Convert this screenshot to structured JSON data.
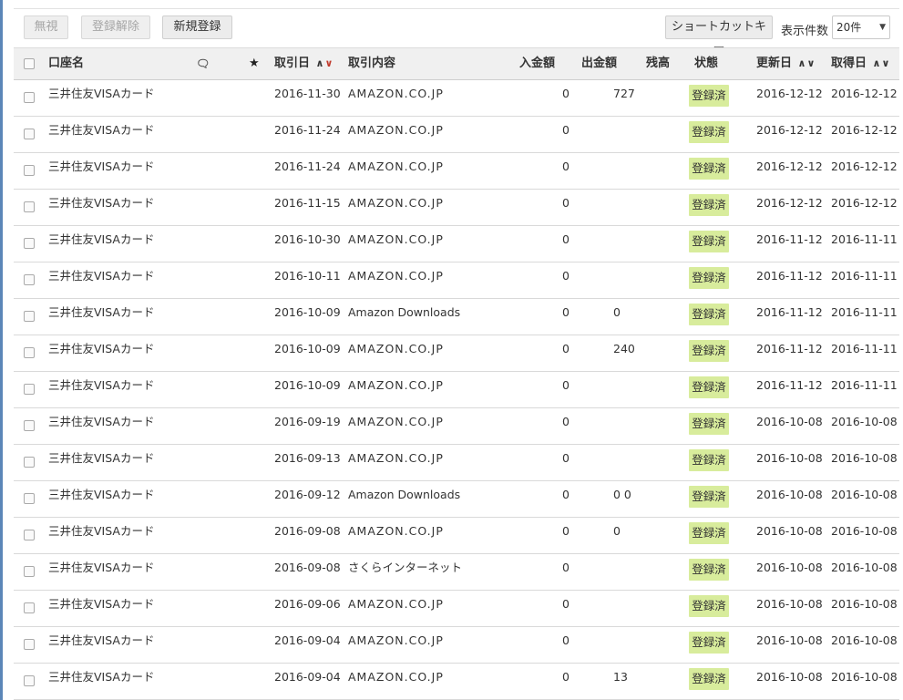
{
  "toolbar": {
    "ignore_label": "無視",
    "unregister_label": "登録解除",
    "new_label": "新規登録",
    "shortcut_label": "ショートカットキー",
    "count_label": "表示件数",
    "count_value": "20件"
  },
  "columns": {
    "account": "口座名",
    "date": "取引日",
    "content": "取引内容",
    "deposit": "入金額",
    "withdrawal": "出金額",
    "balance": "残高",
    "status": "状態",
    "updated": "更新日",
    "acquired": "取得日",
    "sort_up": "∧",
    "sort_down": "∨"
  },
  "rows": [
    {
      "account": "三井住友VISAカード",
      "date": "2016-11-30",
      "content": "AMAZON.CO.JP",
      "deposit": "0",
      "withdrawal": "727",
      "status": "登録済",
      "updated": "2016-12-12",
      "acquired": "2016-12-12"
    },
    {
      "account": "三井住友VISAカード",
      "date": "2016-11-24",
      "content": "AMAZON.CO.JP",
      "deposit": "0",
      "withdrawal": "",
      "status": "登録済",
      "updated": "2016-12-12",
      "acquired": "2016-12-12"
    },
    {
      "account": "三井住友VISAカード",
      "date": "2016-11-24",
      "content": "AMAZON.CO.JP",
      "deposit": "0",
      "withdrawal": "",
      "status": "登録済",
      "updated": "2016-12-12",
      "acquired": "2016-12-12"
    },
    {
      "account": "三井住友VISAカード",
      "date": "2016-11-15",
      "content": "AMAZON.CO.JP",
      "deposit": "0",
      "withdrawal": "",
      "status": "登録済",
      "updated": "2016-12-12",
      "acquired": "2016-12-12"
    },
    {
      "account": "三井住友VISAカード",
      "date": "2016-10-30",
      "content": "AMAZON.CO.JP",
      "deposit": "0",
      "withdrawal": "",
      "status": "登録済",
      "updated": "2016-11-12",
      "acquired": "2016-11-11"
    },
    {
      "account": "三井住友VISAカード",
      "date": "2016-10-11",
      "content": "AMAZON.CO.JP",
      "deposit": "0",
      "withdrawal": "",
      "status": "登録済",
      "updated": "2016-11-12",
      "acquired": "2016-11-11"
    },
    {
      "account": "三井住友VISAカード",
      "date": "2016-10-09",
      "content": "Amazon Downloads",
      "deposit": "0",
      "withdrawal": "0",
      "status": "登録済",
      "updated": "2016-11-12",
      "acquired": "2016-11-11"
    },
    {
      "account": "三井住友VISAカード",
      "date": "2016-10-09",
      "content": "AMAZON.CO.JP",
      "deposit": "0",
      "withdrawal": "240",
      "status": "登録済",
      "updated": "2016-11-12",
      "acquired": "2016-11-11"
    },
    {
      "account": "三井住友VISAカード",
      "date": "2016-10-09",
      "content": "AMAZON.CO.JP",
      "deposit": "0",
      "withdrawal": "",
      "status": "登録済",
      "updated": "2016-11-12",
      "acquired": "2016-11-11"
    },
    {
      "account": "三井住友VISAカード",
      "date": "2016-09-19",
      "content": "AMAZON.CO.JP",
      "deposit": "0",
      "withdrawal": "",
      "status": "登録済",
      "updated": "2016-10-08",
      "acquired": "2016-10-08"
    },
    {
      "account": "三井住友VISAカード",
      "date": "2016-09-13",
      "content": "AMAZON.CO.JP",
      "deposit": "0",
      "withdrawal": "",
      "status": "登録済",
      "updated": "2016-10-08",
      "acquired": "2016-10-08"
    },
    {
      "account": "三井住友VISAカード",
      "date": "2016-09-12",
      "content": "Amazon Downloads",
      "deposit": "0",
      "withdrawal": "0 0",
      "status": "登録済",
      "updated": "2016-10-08",
      "acquired": "2016-10-08"
    },
    {
      "account": "三井住友VISAカード",
      "date": "2016-09-08",
      "content": "AMAZON.CO.JP",
      "deposit": "0",
      "withdrawal": "0",
      "status": "登録済",
      "updated": "2016-10-08",
      "acquired": "2016-10-08"
    },
    {
      "account": "三井住友VISAカード",
      "date": "2016-09-08",
      "content": "さくらインターネット",
      "deposit": "0",
      "withdrawal": "",
      "status": "登録済",
      "updated": "2016-10-08",
      "acquired": "2016-10-08"
    },
    {
      "account": "三井住友VISAカード",
      "date": "2016-09-06",
      "content": "AMAZON.CO.JP",
      "deposit": "0",
      "withdrawal": "",
      "status": "登録済",
      "updated": "2016-10-08",
      "acquired": "2016-10-08"
    },
    {
      "account": "三井住友VISAカード",
      "date": "2016-09-04",
      "content": "AMAZON.CO.JP",
      "deposit": "0",
      "withdrawal": "",
      "status": "登録済",
      "updated": "2016-10-08",
      "acquired": "2016-10-08"
    },
    {
      "account": "三井住友VISAカード",
      "date": "2016-09-04",
      "content": "AMAZON.CO.JP",
      "deposit": "0",
      "withdrawal": "13",
      "status": "登録済",
      "updated": "2016-10-08",
      "acquired": "2016-10-08"
    }
  ]
}
